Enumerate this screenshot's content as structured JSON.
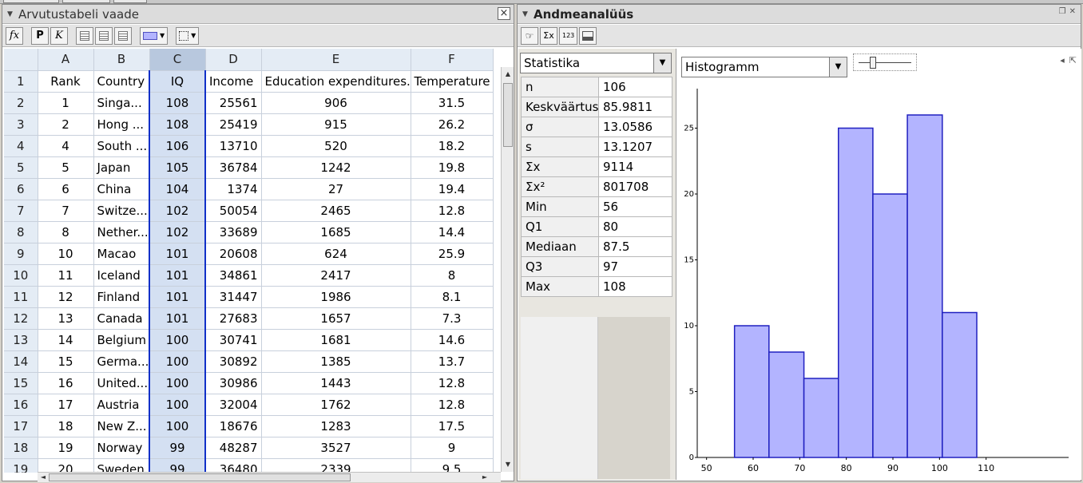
{
  "left_panel": {
    "title": "Arvutustabeli vaade",
    "toolbar": {
      "fx": "fx",
      "bold": "P",
      "italic": "K"
    }
  },
  "spreadsheet": {
    "column_headers": [
      "A",
      "B",
      "C",
      "D",
      "E",
      "F"
    ],
    "rows": [
      {
        "n": "1",
        "cells": [
          "Rank",
          "Country",
          "IQ",
          "Income",
          "Education expenditures...",
          "Temperature"
        ]
      },
      {
        "n": "2",
        "cells": [
          "1",
          "Singa...",
          "108",
          "25561",
          "906",
          "31.5"
        ]
      },
      {
        "n": "3",
        "cells": [
          "2",
          "Hong ...",
          "108",
          "25419",
          "915",
          "26.2"
        ]
      },
      {
        "n": "4",
        "cells": [
          "4",
          "South ...",
          "106",
          "13710",
          "520",
          "18.2"
        ]
      },
      {
        "n": "5",
        "cells": [
          "5",
          "Japan",
          "105",
          "36784",
          "1242",
          "19.8"
        ]
      },
      {
        "n": "6",
        "cells": [
          "6",
          "China",
          "104",
          "1374",
          "27",
          "19.4"
        ]
      },
      {
        "n": "7",
        "cells": [
          "7",
          "Switze...",
          "102",
          "50054",
          "2465",
          "12.8"
        ]
      },
      {
        "n": "8",
        "cells": [
          "8",
          "Nether...",
          "102",
          "33689",
          "1685",
          "14.4"
        ]
      },
      {
        "n": "9",
        "cells": [
          "10",
          "Macao",
          "101",
          "20608",
          "624",
          "25.9"
        ]
      },
      {
        "n": "10",
        "cells": [
          "11",
          "Iceland",
          "101",
          "34861",
          "2417",
          "8"
        ]
      },
      {
        "n": "11",
        "cells": [
          "12",
          "Finland",
          "101",
          "31447",
          "1986",
          "8.1"
        ]
      },
      {
        "n": "12",
        "cells": [
          "13",
          "Canada",
          "101",
          "27683",
          "1657",
          "7.3"
        ]
      },
      {
        "n": "13",
        "cells": [
          "14",
          "Belgium",
          "100",
          "30741",
          "1681",
          "14.6"
        ]
      },
      {
        "n": "14",
        "cells": [
          "15",
          "Germa...",
          "100",
          "30892",
          "1385",
          "13.7"
        ]
      },
      {
        "n": "15",
        "cells": [
          "16",
          "United...",
          "100",
          "30986",
          "1443",
          "12.8"
        ]
      },
      {
        "n": "16",
        "cells": [
          "17",
          "Austria",
          "100",
          "32004",
          "1762",
          "12.8"
        ]
      },
      {
        "n": "17",
        "cells": [
          "18",
          "New Z...",
          "100",
          "18676",
          "1283",
          "17.5"
        ]
      },
      {
        "n": "18",
        "cells": [
          "19",
          "Norway",
          "99",
          "48287",
          "3527",
          "9"
        ]
      },
      {
        "n": "19",
        "cells": [
          "20",
          "Sweden",
          "99",
          "36480",
          "2339",
          "9.5"
        ]
      }
    ]
  },
  "right_panel": {
    "title": "Andmeanalüüs",
    "stats_dropdown": "Statistika",
    "chart_dropdown": "Histogramm",
    "stats": [
      {
        "k": "n",
        "v": "106"
      },
      {
        "k": "Keskväärtus",
        "v": "85.9811"
      },
      {
        "k": "σ",
        "v": "13.0586"
      },
      {
        "k": "s",
        "v": "13.1207"
      },
      {
        "k": "Σx",
        "v": "9114"
      },
      {
        "k": "Σx²",
        "v": "801708"
      },
      {
        "k": "Min",
        "v": "56"
      },
      {
        "k": "Q1",
        "v": "80"
      },
      {
        "k": "Mediaan",
        "v": "87.5"
      },
      {
        "k": "Q3",
        "v": "97"
      },
      {
        "k": "Max",
        "v": "108"
      }
    ]
  },
  "colors": {
    "bar_fill": "#b3b4ff",
    "bar_stroke": "#2020c0",
    "selected_column": "#d4e0f2"
  },
  "chart_data": {
    "type": "bar",
    "title": "",
    "xlabel": "",
    "ylabel": "",
    "bins": [
      {
        "from": 56,
        "to": 63.4,
        "count": 10
      },
      {
        "from": 63.4,
        "to": 70.9,
        "count": 8
      },
      {
        "from": 70.9,
        "to": 78.3,
        "count": 6
      },
      {
        "from": 78.3,
        "to": 85.7,
        "count": 25
      },
      {
        "from": 85.7,
        "to": 93.1,
        "count": 20
      },
      {
        "from": 93.1,
        "to": 100.6,
        "count": 26
      },
      {
        "from": 100.6,
        "to": 108,
        "count": 11
      }
    ],
    "xlim": [
      48,
      126
    ],
    "ylim": [
      0,
      28
    ],
    "x_ticks": [
      "50",
      "60",
      "70",
      "80",
      "90",
      "100",
      "110"
    ],
    "y_ticks": [
      "0",
      "5",
      "10",
      "15",
      "20",
      "25"
    ],
    "grid": false
  }
}
